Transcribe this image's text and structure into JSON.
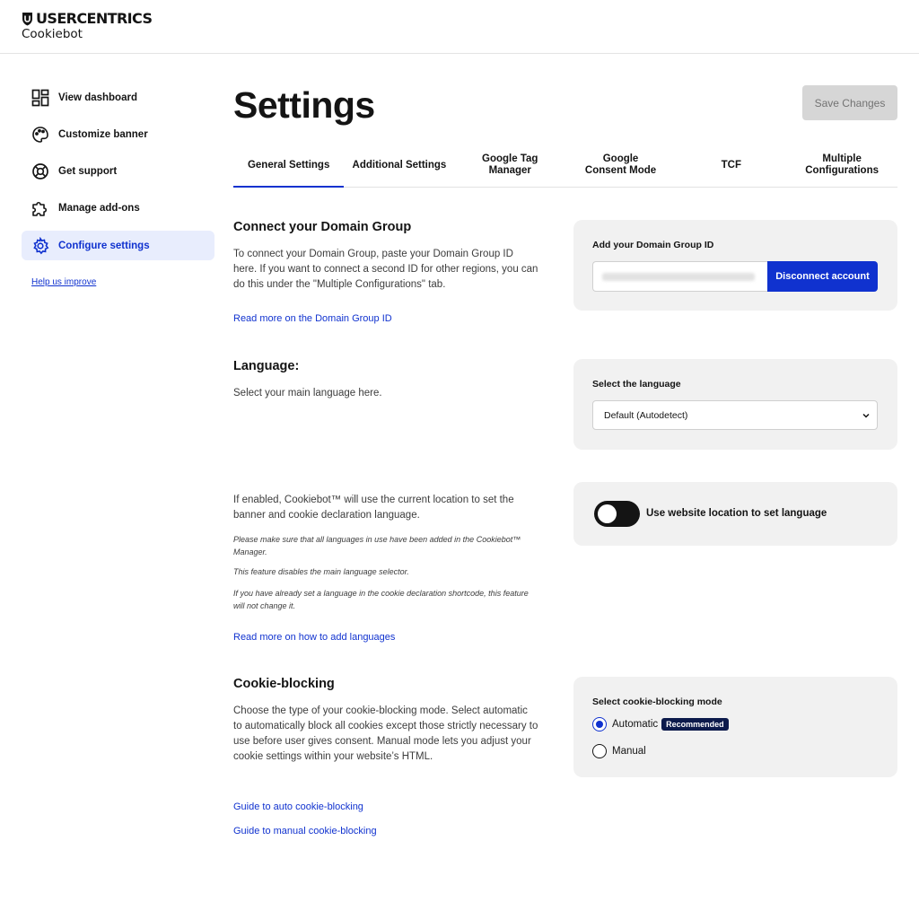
{
  "header": {
    "brand": "USERCENTRICS",
    "product": "Cookiebot"
  },
  "sidebar": {
    "items": [
      {
        "label": "View dashboard",
        "icon": "dashboard-icon"
      },
      {
        "label": "Customize banner",
        "icon": "palette-icon"
      },
      {
        "label": "Get support",
        "icon": "lifebuoy-icon"
      },
      {
        "label": "Manage add-ons",
        "icon": "puzzle-icon"
      },
      {
        "label": "Configure settings",
        "icon": "gear-icon",
        "active": true
      }
    ],
    "help_link": "Help us improve"
  },
  "main": {
    "title": "Settings",
    "save_label": "Save Changes",
    "tabs": [
      {
        "label": "General Settings",
        "active": true
      },
      {
        "label": "Additional Settings"
      },
      {
        "label": "Google Tag Manager"
      },
      {
        "label": "Google Consent Mode"
      },
      {
        "label": "TCF"
      },
      {
        "label": "Multiple Configurations"
      }
    ]
  },
  "domain_group": {
    "title": "Connect your Domain Group",
    "description": "To connect your Domain Group, paste your Domain Group ID here. If you want to connect a second ID for other regions, you can do this under the \"Multiple Configurations\" tab.",
    "link": "Read more on the Domain Group ID",
    "card_label": "Add your Domain Group ID",
    "button": "Disconnect account"
  },
  "language": {
    "title": "Language:",
    "description": "Select your main language here.",
    "card_label": "Select the language",
    "selected": "Default (Autodetect)"
  },
  "location": {
    "description": "If enabled, Cookiebot™ will use the current location to set the banner and cookie declaration language.",
    "notes": [
      "Please make sure that all languages in use have been added in the Cookiebot™ Manager.",
      "This feature disables the main language selector.",
      "If you have already set a language in the cookie declaration shortcode, this feature will not change it."
    ],
    "link": "Read more on how to add languages",
    "toggle_label": "Use website location to set language",
    "toggle_on": false
  },
  "cookie_blocking": {
    "title": "Cookie-blocking",
    "description": "Choose the type of your cookie-blocking mode. Select automatic to automatically block all cookies except those strictly necessary to use before user gives consent. Manual mode lets you adjust your cookie settings within your website’s HTML.",
    "links": [
      "Guide to auto cookie-blocking",
      "Guide to manual cookie-blocking"
    ],
    "card_label": "Select cookie-blocking mode",
    "options": [
      {
        "label": "Automatic",
        "badge": "Recommended",
        "checked": true
      },
      {
        "label": "Manual",
        "checked": false
      }
    ]
  },
  "colors": {
    "accent": "#1032cf",
    "active_nav_bg": "#e8edfd",
    "card_bg": "#f1f1f1",
    "badge_bg": "#0c1a4b"
  }
}
